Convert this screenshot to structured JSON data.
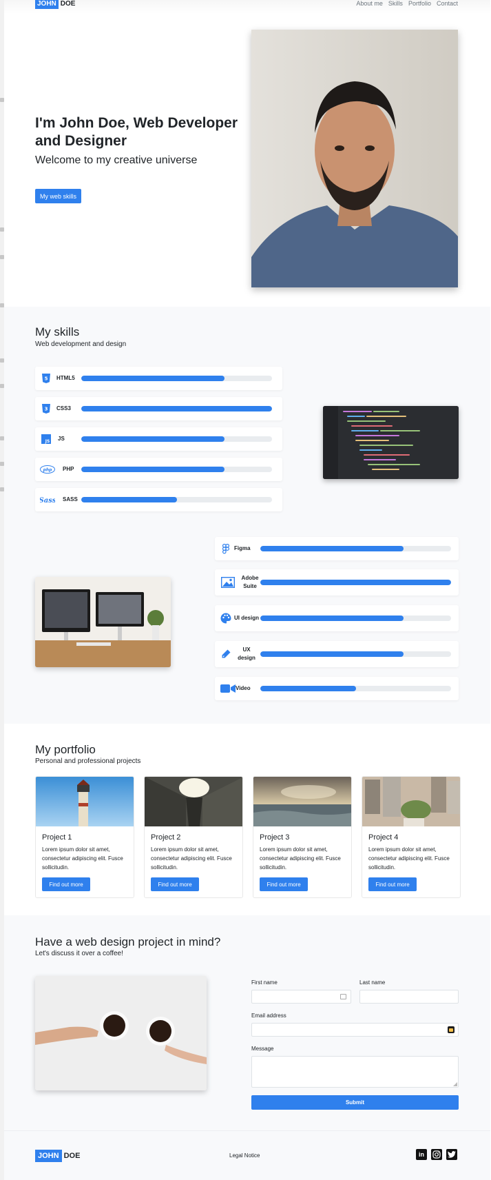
{
  "nav": {
    "brand_box": "JOHN",
    "brand_rest": "DOE",
    "links": [
      "About me",
      "Skills",
      "Portfolio",
      "Contact"
    ]
  },
  "hero": {
    "title": "I'm John Doe, Web Developer and Designer",
    "subtitle": "Welcome to my creative universe",
    "button": "My web skills"
  },
  "skills": {
    "title": "My skills",
    "subtitle": "Web development and design",
    "dev": [
      {
        "label": "HTML5",
        "icon": "html5-icon",
        "level": 0.75
      },
      {
        "label": "CSS3",
        "icon": "css3-icon",
        "level": 1.0
      },
      {
        "label": "JS",
        "icon": "js-icon",
        "level": 0.75
      },
      {
        "label": "PHP",
        "icon": "php-icon",
        "level": 0.75
      },
      {
        "label": "SASS",
        "icon": "sass-icon",
        "level": 0.5
      }
    ],
    "design": [
      {
        "label": "Figma",
        "icon": "figma-icon",
        "level": 0.75
      },
      {
        "label": "Adobe Suite",
        "icon": "image-icon",
        "level": 1.0
      },
      {
        "label": "UI design",
        "icon": "palette-icon",
        "level": 0.75
      },
      {
        "label": "UX design",
        "icon": "pen-icon",
        "level": 0.75
      },
      {
        "label": "Video",
        "icon": "video-camera-icon",
        "level": 0.5
      }
    ]
  },
  "portfolio": {
    "title": "My portfolio",
    "subtitle": "Personal and professional projects",
    "projects": [
      {
        "title": "Project 1",
        "text": "Lorem ipsum dolor sit amet, consectetur adipiscing elit. Fusce sollicitudin.",
        "button": "Find out more"
      },
      {
        "title": "Project 2",
        "text": "Lorem ipsum dolor sit amet, consectetur adipiscing elit. Fusce sollicitudin.",
        "button": "Find out more"
      },
      {
        "title": "Project 3",
        "text": "Lorem ipsum dolor sit amet, consectetur adipiscing elit. Fusce sollicitudin.",
        "button": "Find out more"
      },
      {
        "title": "Project 4",
        "text": "Lorem ipsum dolor sit amet, consectetur adipiscing elit. Fusce sollicitudin.",
        "button": "Find out more"
      }
    ]
  },
  "contact": {
    "title": "Have a web design project in mind?",
    "subtitle": "Let's discuss it over a coffee!",
    "first_name_label": "First name",
    "last_name_label": "Last name",
    "email_label": "Email address",
    "message_label": "Message",
    "submit": "Submit"
  },
  "footer": {
    "brand_box": "JOHN",
    "brand_rest": "DOE",
    "legal": "Legal Notice",
    "social_icons": [
      "linkedin-icon",
      "instagram-icon",
      "twitter-icon"
    ]
  },
  "colors": {
    "accent": "#2f80ed",
    "section_bg": "#f8f9fb",
    "track": "#e9ecef"
  }
}
